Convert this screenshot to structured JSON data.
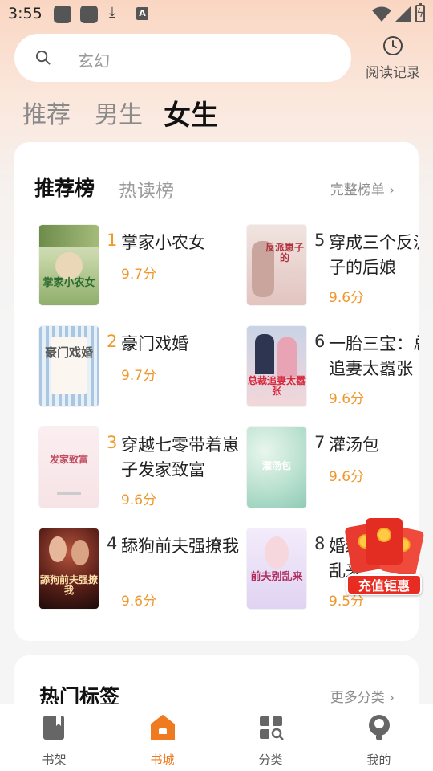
{
  "status_bar": {
    "time": "3:55",
    "download_glyph": "⤓",
    "app_badge": "A",
    "battery_glyph": "ϟ"
  },
  "search": {
    "placeholder": "玄幻"
  },
  "history": {
    "label": "阅读记录"
  },
  "channel_tabs": [
    {
      "label": "推荐",
      "active": false
    },
    {
      "label": "男生",
      "active": false
    },
    {
      "label": "女生",
      "active": true
    }
  ],
  "ranking": {
    "tabs": [
      {
        "label": "推荐榜",
        "active": true
      },
      {
        "label": "热读榜",
        "active": false
      }
    ],
    "more_label": "完整榜单 ›",
    "books": [
      {
        "rank": "1",
        "title": "掌家小农女",
        "score": "9.7分",
        "cover_text": "掌家小农女"
      },
      {
        "rank": "2",
        "title": "豪门戏婚",
        "score": "9.7分",
        "cover_text": "豪门戏婚"
      },
      {
        "rank": "3",
        "title": "穿越七零带着崽子发家致富",
        "score": "9.6分",
        "cover_text": "发家致富"
      },
      {
        "rank": "4",
        "title": "舔狗前夫强撩我",
        "score": "9.6分",
        "cover_text": "舔狗前夫强撩我"
      },
      {
        "rank": "5",
        "title": "穿成三个反派崽子的后娘",
        "score": "9.6分",
        "cover_text": "反派崽子的"
      },
      {
        "rank": "6",
        "title": "一胎三宝：总裁追妻太嚣张",
        "score": "9.6分",
        "cover_text": "总裁追妻太嚣张"
      },
      {
        "rank": "7",
        "title": "灌汤包",
        "score": "9.6分",
        "cover_text": "灌汤包"
      },
      {
        "rank": "8",
        "title": "婚缠：前夫，别乱来",
        "score": "9.5分",
        "cover_text": "前夫别乱来"
      }
    ]
  },
  "promo": {
    "label": "充值钜惠"
  },
  "hot_tags": {
    "title": "热门标签",
    "more_label": "更多分类 ›"
  },
  "bottom_nav": [
    {
      "label": "书架",
      "icon": "bookshelf-icon",
      "active": false
    },
    {
      "label": "书城",
      "icon": "bookstore-icon",
      "active": true
    },
    {
      "label": "分类",
      "icon": "category-icon",
      "active": false
    },
    {
      "label": "我的",
      "icon": "profile-icon",
      "active": false
    }
  ],
  "colors": {
    "accent": "#f07a20",
    "score": "#f0962a",
    "rank_top": "#f39a26",
    "promo_red": "#e82c22"
  }
}
